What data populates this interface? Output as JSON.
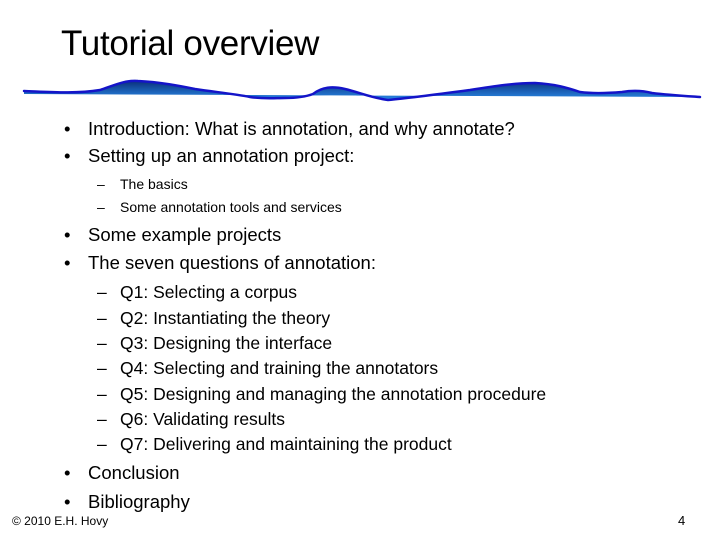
{
  "slide": {
    "title": "Tutorial overview",
    "bullet_marker": "•",
    "dash_marker": "–",
    "items": [
      {
        "level": 1,
        "text": "Introduction: What is annotation, and why annotate?"
      },
      {
        "level": 1,
        "text": "Setting up an annotation project:"
      },
      {
        "level": 2,
        "text": "The basics"
      },
      {
        "level": 2,
        "text": "Some annotation tools and services"
      },
      {
        "level": 1,
        "text": "Some example projects"
      },
      {
        "level": 1,
        "text": "The seven questions of annotation:"
      },
      {
        "level": 2,
        "text": "Q1: Selecting a corpus"
      },
      {
        "level": 2,
        "text": "Q2: Instantiating the theory"
      },
      {
        "level": 2,
        "text": "Q3: Designing the interface"
      },
      {
        "level": 2,
        "text": "Q4: Selecting and training the annotators"
      },
      {
        "level": 2,
        "text": "Q5: Designing and managing the annotation procedure"
      },
      {
        "level": 2,
        "text": "Q6: Validating results"
      },
      {
        "level": 2,
        "text": "Q7: Delivering and maintaining the product"
      },
      {
        "level": 1,
        "text": "Conclusion"
      },
      {
        "level": 1,
        "text": "Bibliography"
      }
    ]
  },
  "footer": {
    "copyright": "© 2010  E.H. Hovy",
    "page_number": "4"
  },
  "decoration": {
    "wave_icon": "blue-wave-divider",
    "wave_stroke": "#1a1ad0",
    "wave_fill_dark": "#0a3a8a",
    "wave_fill_light": "#2a7ae0"
  }
}
